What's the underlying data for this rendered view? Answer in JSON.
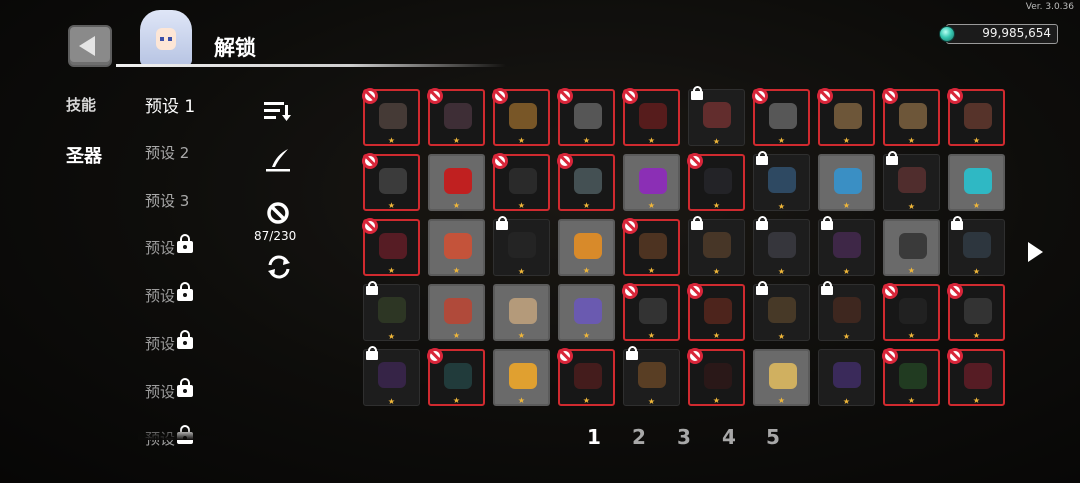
{
  "version": "Ver. 3.0.36",
  "currency": {
    "amount": "99,985,654",
    "icon": "gem-icon",
    "color": "#38c9b3"
  },
  "header": {
    "title": "解锁"
  },
  "categories": [
    {
      "label": "技能",
      "active": false
    },
    {
      "label": "圣器",
      "active": true
    }
  ],
  "presets": [
    {
      "label": "预设 1",
      "state": "active"
    },
    {
      "label": "预设 2",
      "state": "unlocked"
    },
    {
      "label": "预设 3",
      "state": "unlocked"
    },
    {
      "label": "预设",
      "state": "locked"
    },
    {
      "label": "预设",
      "state": "locked"
    },
    {
      "label": "预设",
      "state": "locked"
    },
    {
      "label": "预设",
      "state": "locked"
    },
    {
      "label": "预设",
      "state": "locked"
    }
  ],
  "tools": {
    "sort_icon": "sort-icon",
    "edit_icon": "quill-icon",
    "ban_icon": "ban-icon",
    "counter": "87/230",
    "refresh_icon": "refresh-icon"
  },
  "grid": {
    "rows": [
      [
        {
          "state": "banned",
          "frame": "red",
          "item": "#6b5750"
        },
        {
          "state": "banned",
          "frame": "red",
          "item": "#5e4150"
        },
        {
          "state": "banned",
          "frame": "red",
          "item": "#c98a34"
        },
        {
          "state": "banned",
          "frame": "red",
          "item": "#8a8a8a"
        },
        {
          "state": "banned",
          "frame": "red",
          "item": "#8a2020"
        },
        {
          "state": "locked",
          "frame": "dark",
          "item": "#9b3a3a"
        },
        {
          "state": "banned",
          "frame": "red",
          "item": "#8d8d8d"
        },
        {
          "state": "banned",
          "frame": "red",
          "item": "#b58b56"
        },
        {
          "state": "banned",
          "frame": "red",
          "item": "#b58b56"
        },
        {
          "state": "banned",
          "frame": "red",
          "item": "#8a4a3a"
        }
      ],
      [
        {
          "state": "banned",
          "frame": "red",
          "item": "#5a5a5a"
        },
        {
          "state": "normal",
          "frame": "light",
          "item": "#c02020"
        },
        {
          "state": "banned",
          "frame": "red",
          "item": "#3a3a3a"
        },
        {
          "state": "banned",
          "frame": "red",
          "item": "#6a7f85"
        },
        {
          "state": "normal",
          "frame": "light",
          "item": "#8b2fb5"
        },
        {
          "state": "banned",
          "frame": "red",
          "item": "#2e2e34"
        },
        {
          "state": "locked",
          "frame": "dark",
          "item": "#3d6e9a"
        },
        {
          "state": "normal",
          "frame": "light",
          "item": "#3a8fc4"
        },
        {
          "state": "locked",
          "frame": "dark",
          "item": "#7a3a3a"
        },
        {
          "state": "normal",
          "frame": "light",
          "item": "#2fb8c4"
        }
      ],
      [
        {
          "state": "banned",
          "frame": "red",
          "item": "#8a2030"
        },
        {
          "state": "normal",
          "frame": "light",
          "item": "#c4533a"
        },
        {
          "state": "locked",
          "frame": "dark",
          "item": "#2a2a2a"
        },
        {
          "state": "normal",
          "frame": "light",
          "item": "#d88a2a"
        },
        {
          "state": "banned",
          "frame": "red",
          "item": "#7a4a2a"
        },
        {
          "state": "locked",
          "frame": "dark",
          "item": "#6a4a30"
        },
        {
          "state": "locked",
          "frame": "dark",
          "item": "#4a4a55"
        },
        {
          "state": "locked",
          "frame": "dark",
          "item": "#5a2f6a"
        },
        {
          "state": "normal",
          "frame": "light",
          "item": "#3a3a3a"
        },
        {
          "state": "locked",
          "frame": "dark",
          "item": "#3a4a5a"
        }
      ],
      [
        {
          "state": "locked",
          "frame": "dark",
          "item": "#3a4a2a"
        },
        {
          "state": "normal",
          "frame": "light",
          "item": "#b04a3a"
        },
        {
          "state": "normal",
          "frame": "light",
          "item": "#b49a7a"
        },
        {
          "state": "normal",
          "frame": "light",
          "item": "#6a5ab0"
        },
        {
          "state": "banned",
          "frame": "red",
          "item": "#4a4a4a"
        },
        {
          "state": "banned",
          "frame": "red",
          "item": "#7a3020"
        },
        {
          "state": "locked",
          "frame": "dark",
          "item": "#6a5030"
        },
        {
          "state": "locked",
          "frame": "dark",
          "item": "#5a3020"
        },
        {
          "state": "banned",
          "frame": "red",
          "item": "#2a2a2a"
        },
        {
          "state": "banned",
          "frame": "red",
          "item": "#4a4a4a"
        }
      ],
      [
        {
          "state": "locked",
          "frame": "dark",
          "item": "#4a2a6a"
        },
        {
          "state": "banned",
          "frame": "red",
          "item": "#2a5a5a"
        },
        {
          "state": "normal",
          "frame": "light",
          "item": "#e0a030"
        },
        {
          "state": "banned",
          "frame": "red",
          "item": "#6a2020"
        },
        {
          "state": "locked",
          "frame": "dark",
          "item": "#8a5a2a"
        },
        {
          "state": "banned",
          "frame": "red",
          "item": "#3a1a1a"
        },
        {
          "state": "normal",
          "frame": "light",
          "item": "#d0b060"
        },
        {
          "state": "normal",
          "frame": "dark",
          "item": "#3a2a5a"
        },
        {
          "state": "banned",
          "frame": "red",
          "item": "#2a5a2a"
        },
        {
          "state": "banned",
          "frame": "red",
          "item": "#8a2030"
        }
      ]
    ]
  },
  "pagination": {
    "pages": [
      "1",
      "2",
      "3",
      "4",
      "5"
    ],
    "active": "1"
  },
  "colors": {
    "banned_frame": "#d02a2f",
    "star": "#f0b73a"
  }
}
